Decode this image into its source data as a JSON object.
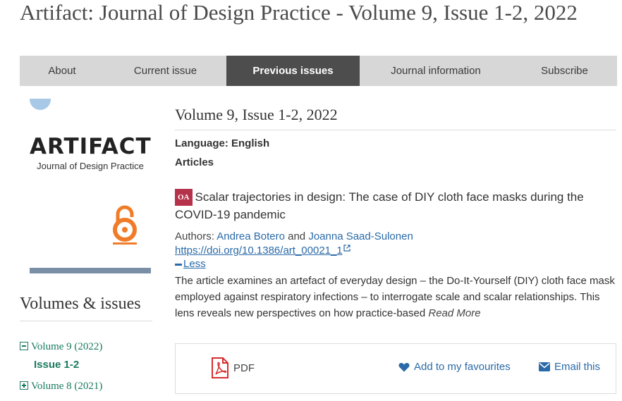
{
  "page": {
    "title": "Artifact: Journal of Design Practice - Volume 9, Issue 1-2, 2022"
  },
  "nav": {
    "items": [
      {
        "label": "About"
      },
      {
        "label": "Current issue"
      },
      {
        "label": "Previous issues",
        "active": true
      },
      {
        "label": "Journal information"
      },
      {
        "label": "Subscribe"
      }
    ]
  },
  "cover": {
    "title": "ARTIFACT",
    "subtitle": "Journal of Design Practice",
    "logo_icon": "open-access-logo-icon"
  },
  "sidebar": {
    "heading": "Volumes & issues",
    "volumes": [
      {
        "label": "Volume 9 (2022)",
        "expanded": true,
        "issues": [
          {
            "label": "Issue 1-2"
          }
        ]
      },
      {
        "label": "Volume 8 (2021)",
        "expanded": false
      }
    ]
  },
  "issue": {
    "title": "Volume 9, Issue 1-2, 2022",
    "language": "Language: English",
    "section": "Articles"
  },
  "article": {
    "badge": "OA",
    "title": "Scalar trajectories in design: The case of DIY cloth face masks during the COVID-19 pandemic",
    "authors_label": "Authors:",
    "author_1": "Andrea Botero",
    "conjunction": "and",
    "author_2": "Joanna Saad-Sulonen",
    "doi": "https://doi.org/10.1386/art_00021_1",
    "less_label": "Less",
    "abstract": "The article examines an artefact of everyday design – the Do-It-Yourself (DIY) cloth face mask employed against respiratory infections – to interrogate scale and scalar relationships. This lens reveals new perspectives on how practice-based",
    "read_more": "Read More"
  },
  "actions": {
    "pdf_label": "PDF",
    "favourite_label": "Add to my favourites",
    "email_label": "Email this"
  },
  "colors": {
    "nav_bg": "#d7d7d7",
    "nav_active": "#4d4d4d",
    "link": "#2a6aa8",
    "sidebar_link": "#1a7a5e",
    "oa_badge": "#b5324a",
    "pdf_icon": "#d62e2e"
  }
}
